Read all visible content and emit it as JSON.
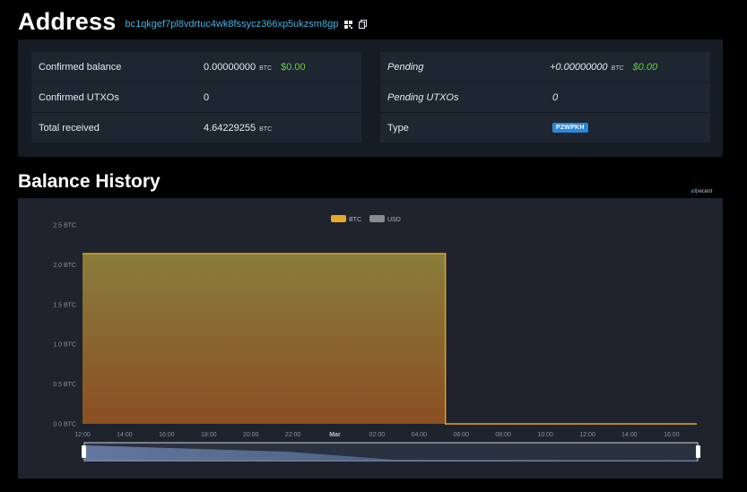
{
  "header": {
    "title": "Address",
    "hash": "bc1qkgef7pl8vdrtuc4wk8fssycz366xp5ukzsm8gp"
  },
  "summary": {
    "confirmed_balance": {
      "label": "Confirmed balance",
      "value": "0.00000000",
      "unit": "BTC",
      "usd": "$0.00"
    },
    "pending": {
      "label": "Pending",
      "value": "+0.00000000",
      "unit": "BTC",
      "usd": "$0.00"
    },
    "confirmed_utxos": {
      "label": "Confirmed UTXOs",
      "value": "0"
    },
    "pending_utxos": {
      "label": "Pending UTXOs",
      "value": "0"
    },
    "total_received": {
      "label": "Total received",
      "value": "4.64229255",
      "unit": "BTC"
    },
    "type": {
      "label": "Type",
      "value": "P2WPKH"
    }
  },
  "history": {
    "title": "Balance History",
    "range_all": "all",
    "range_sep": "|",
    "range_recent": "recent"
  },
  "colors": {
    "accent": "#3fb6e6",
    "usd_green": "#5dd23d",
    "badge_blue": "#2d86d6",
    "btc_line": "#e6a82a",
    "usd_legend": "#8a8a8a"
  },
  "chart_data": {
    "type": "area",
    "legend": [
      {
        "name": "BTC",
        "color": "#e6a82a",
        "active": true
      },
      {
        "name": "USD",
        "color": "#8a8a8a",
        "active": false
      }
    ],
    "y_ticks": [
      "0.0 BTC",
      "0.5 BTC",
      "1.0 BTC",
      "1.5 BTC",
      "2.0 BTC",
      "2.5 BTC"
    ],
    "ylim": [
      0,
      2.5
    ],
    "x_ticks": [
      "12:00",
      "14:00",
      "16:00",
      "18:00",
      "20:00",
      "22:00",
      "Mar",
      "02:00",
      "04:00",
      "06:00",
      "08:00",
      "10:00",
      "12:00",
      "14:00",
      "16:00"
    ],
    "x_bold": [
      "Mar"
    ],
    "xlim_hours": [
      -12,
      17.2
    ],
    "series": [
      {
        "name": "BTC",
        "steps": [
          {
            "x": -12,
            "y": 2.14
          },
          {
            "x": 5.25,
            "y": 2.14
          },
          {
            "x": 5.25,
            "y": 0.0
          },
          {
            "x": 17.2,
            "y": 0.0
          }
        ]
      }
    ]
  }
}
